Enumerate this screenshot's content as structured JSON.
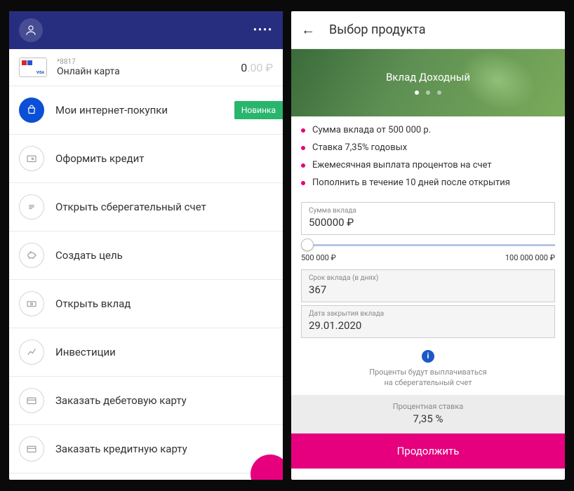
{
  "left": {
    "card": {
      "last4_label": "*8817",
      "name": "Онлайн карта",
      "balance_int": "0",
      "balance_dec": ".00 ₽"
    },
    "rows": [
      {
        "label": "Мои интернет-покупки",
        "badge": "Новинка"
      },
      {
        "label": "Оформить кредит"
      },
      {
        "label": "Открыть сберегательный счет"
      },
      {
        "label": "Создать цель"
      },
      {
        "label": "Открыть вклад"
      },
      {
        "label": "Инвестиции"
      },
      {
        "label": "Заказать дебетовую карту"
      },
      {
        "label": "Заказать кредитную карту"
      }
    ]
  },
  "right": {
    "title": "Выбор продукта",
    "promo_title": "Вклад Доходный",
    "bullets": [
      "Сумма вклада от 500 000 р.",
      "Ставка 7,35% годовых",
      "Ежемесячная выплата процентов на счет",
      "Пополнить в течение 10 дней после открытия"
    ],
    "amount_label": "Сумма вклада",
    "amount_value": "500000 ₽",
    "slider_min": "500 000 ₽",
    "slider_max": "100 000 000 ₽",
    "term_label": "Срок вклада (в днях)",
    "term_value": "367",
    "close_label": "Дата закрытия вклада",
    "close_value": "29.01.2020",
    "info_text_1": "Проценты будут выплачиваться",
    "info_text_2": "на сберегательный счет",
    "rate_label": "Процентная ставка",
    "rate_value": "7,35 %",
    "continue": "Продолжить"
  }
}
